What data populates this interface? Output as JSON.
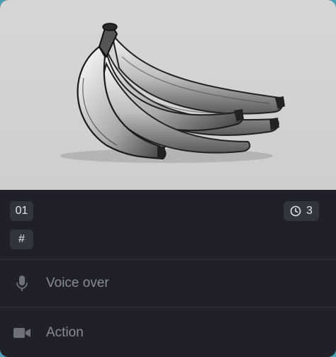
{
  "card": {
    "image": {
      "subject": "banana-bunch-sketch"
    },
    "scene_number": "01",
    "duration_value": "3",
    "hash_label": "#",
    "voice_over": {
      "placeholder": "Voice over",
      "icon": "microphone-icon"
    },
    "action": {
      "placeholder": "Action",
      "icon": "video-camera-icon"
    }
  },
  "colors": {
    "card_bg": "#1f2028",
    "badge_bg": "#32343e",
    "text_light": "#e4e5ea",
    "text_muted": "#8a8c95",
    "image_bg": "#d2d2d2"
  }
}
